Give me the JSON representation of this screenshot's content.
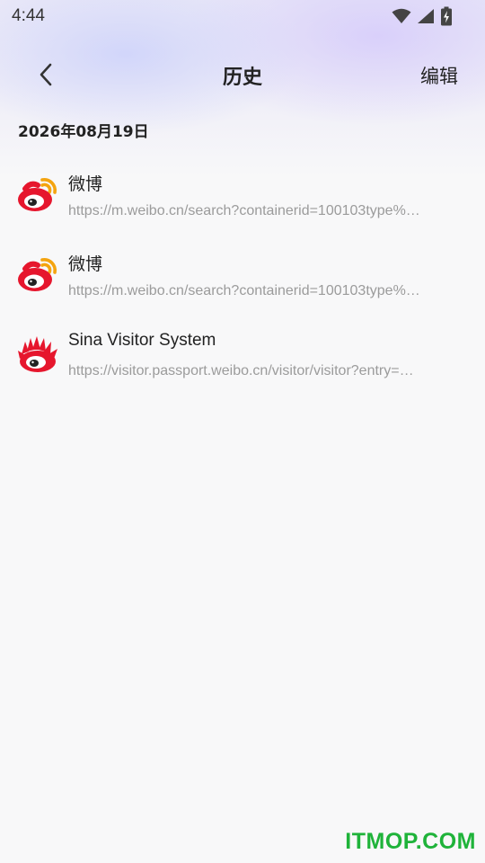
{
  "status_bar": {
    "time": "4:44",
    "icons": [
      "wifi-icon",
      "signal-icon",
      "battery-icon"
    ]
  },
  "header": {
    "title": "历史",
    "edit_label": "编辑",
    "back_icon": "chevron-left-icon"
  },
  "history": {
    "date": "2026年08月19日",
    "items": [
      {
        "title": "微博",
        "url": "https://m.weibo.cn/search?containerid=100103type%…",
        "icon": "weibo-logo-icon"
      },
      {
        "title": "微博",
        "url": "https://m.weibo.cn/search?containerid=100103type%…",
        "icon": "weibo-logo-icon"
      },
      {
        "title": "Sina Visitor System",
        "url": "https://visitor.passport.weibo.cn/visitor/visitor?entry=…",
        "icon": "sina-logo-icon"
      }
    ]
  },
  "watermark": "ITMOP.COM",
  "colors": {
    "background": "#f8f8f9",
    "weibo_red": "#e6162d",
    "weibo_orange": "#f4a40f",
    "url_gray": "#9b9b9b",
    "watermark_green": "#1fb33a"
  }
}
